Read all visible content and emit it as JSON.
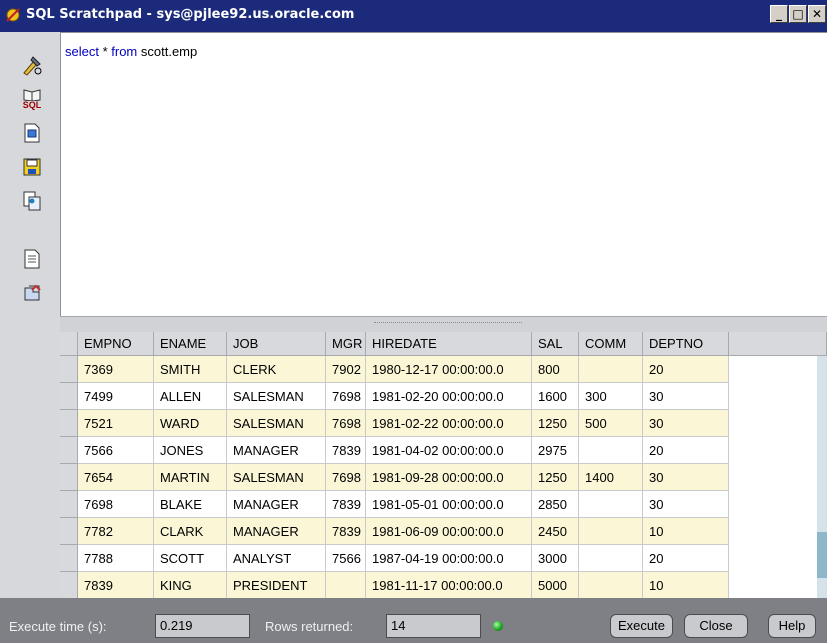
{
  "window": {
    "title": "SQL Scratchpad - sys@pjlee92.us.oracle.com"
  },
  "toolbar": {
    "icons": [
      "execute-icon",
      "sql-reference-icon",
      "open-file-icon",
      "save-icon",
      "explain-plan-icon",
      "document-icon",
      "copy-results-icon"
    ],
    "sql_label": "SQL"
  },
  "editor": {
    "keyword_select": "select",
    "rest_of_query": " * ",
    "keyword_from": "from",
    "table_name": " scott.emp"
  },
  "grid": {
    "columns": [
      "EMPNO",
      "ENAME",
      "JOB",
      "MGR",
      "HIREDATE",
      "SAL",
      "COMM",
      "DEPTNO"
    ],
    "rows": [
      [
        "7369",
        "SMITH",
        "CLERK",
        "7902",
        "1980-12-17 00:00:00.0",
        "800",
        "",
        "20"
      ],
      [
        "7499",
        "ALLEN",
        "SALESMAN",
        "7698",
        "1981-02-20 00:00:00.0",
        "1600",
        "300",
        "30"
      ],
      [
        "7521",
        "WARD",
        "SALESMAN",
        "7698",
        "1981-02-22 00:00:00.0",
        "1250",
        "500",
        "30"
      ],
      [
        "7566",
        "JONES",
        "MANAGER",
        "7839",
        "1981-04-02 00:00:00.0",
        "2975",
        "",
        "20"
      ],
      [
        "7654",
        "MARTIN",
        "SALESMAN",
        "7698",
        "1981-09-28 00:00:00.0",
        "1250",
        "1400",
        "30"
      ],
      [
        "7698",
        "BLAKE",
        "MANAGER",
        "7839",
        "1981-05-01 00:00:00.0",
        "2850",
        "",
        "30"
      ],
      [
        "7782",
        "CLARK",
        "MANAGER",
        "7839",
        "1981-06-09 00:00:00.0",
        "2450",
        "",
        "10"
      ],
      [
        "7788",
        "SCOTT",
        "ANALYST",
        "7566",
        "1987-04-19 00:00:00.0",
        "3000",
        "",
        "20"
      ],
      [
        "7839",
        "KING",
        "PRESIDENT",
        "",
        "1981-11-17 00:00:00.0",
        "5000",
        "",
        "10"
      ]
    ],
    "odd_row_color": "#fbf7d6",
    "scroll_position": 0.9
  },
  "status": {
    "execute_time_label": "Execute time (s):",
    "execute_time_value": "0.219",
    "rows_returned_label": "Rows returned:",
    "rows_returned_value": "14",
    "indicator_color": "#1aa01a",
    "execute_button": "Execute",
    "close_button": "Close",
    "help_button": "Help"
  }
}
